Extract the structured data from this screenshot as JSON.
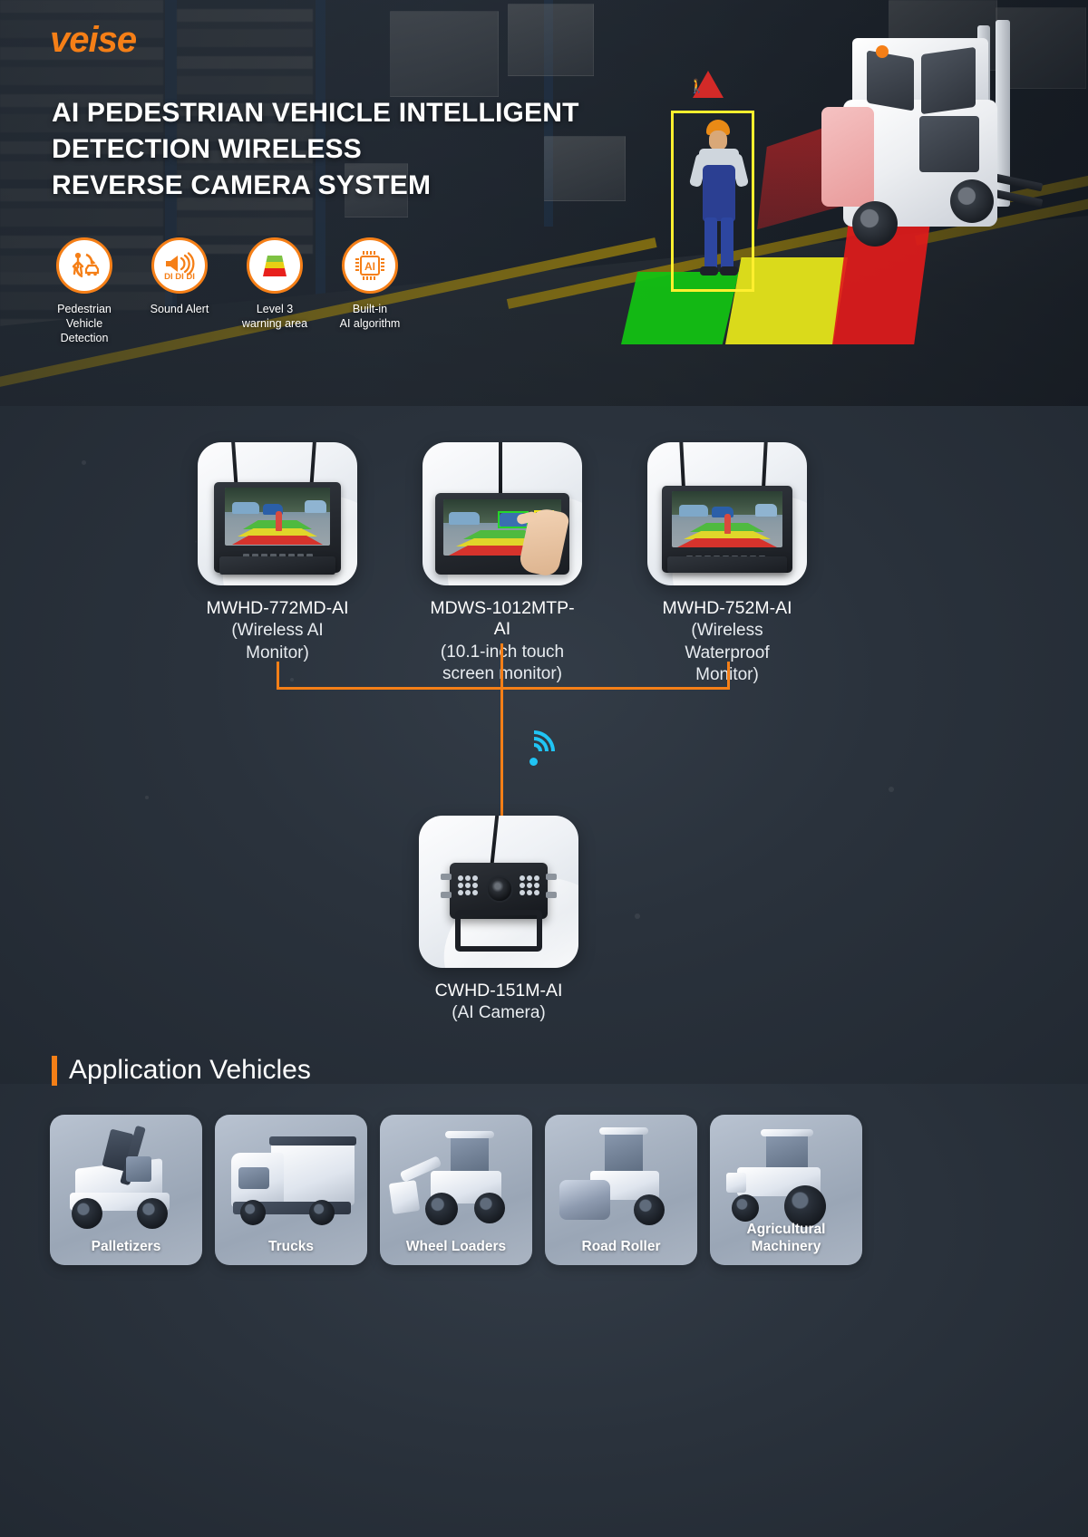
{
  "brand": {
    "logo": "veise"
  },
  "hero": {
    "title_lines": [
      "AI PEDESTRIAN VEHICLE INTELLIGENT",
      "DETECTION WIRELESS",
      "REVERSE CAMERA SYSTEM"
    ],
    "features": [
      {
        "icon": "pedestrian-vehicle-detection-icon",
        "label": "Pedestrian\nVehicle\nDetection",
        "badge": ""
      },
      {
        "icon": "sound-alert-icon",
        "label": "Sound Alert",
        "badge": "DI DI DI"
      },
      {
        "icon": "warning-level-icon",
        "label": "Level 3\nwarning area",
        "badge": ""
      },
      {
        "icon": "ai-chip-icon",
        "label": "Built-in\nAI algorithm",
        "badge": ""
      }
    ],
    "scene": {
      "zones": [
        "green",
        "yellow",
        "red"
      ],
      "pedestrian_box_color": "#ffef2e",
      "warning_sign": "pedestrian-warning-triangle"
    }
  },
  "diagram": {
    "monitors": [
      {
        "model": "MWHD-772MD-AI",
        "desc": "(Wireless AI Monitor)"
      },
      {
        "model": "MDWS-1012MTP-AI",
        "desc": "(10.1-inch touch\nscreen monitor)"
      },
      {
        "model": "MWHD-752M-AI",
        "desc": "(Wireless Waterproof\nMonitor)"
      }
    ],
    "camera": {
      "model": "CWHD-151M-AI",
      "desc": "(AI Camera)"
    },
    "wifi_icon": "wifi-signal-icon",
    "connector_color": "#f57f17",
    "wifi_color": "#20c4f4"
  },
  "applications": {
    "heading": "Application Vehicles",
    "accent": "#f57f17",
    "vehicles": [
      {
        "label": "Palletizers",
        "icon": "telehandler-icon"
      },
      {
        "label": "Trucks",
        "icon": "truck-icon"
      },
      {
        "label": "Wheel Loaders",
        "icon": "wheel-loader-icon"
      },
      {
        "label": "Road Roller",
        "icon": "road-roller-icon"
      },
      {
        "label": "Agricultural\nMachinery",
        "icon": "tractor-icon"
      }
    ]
  }
}
